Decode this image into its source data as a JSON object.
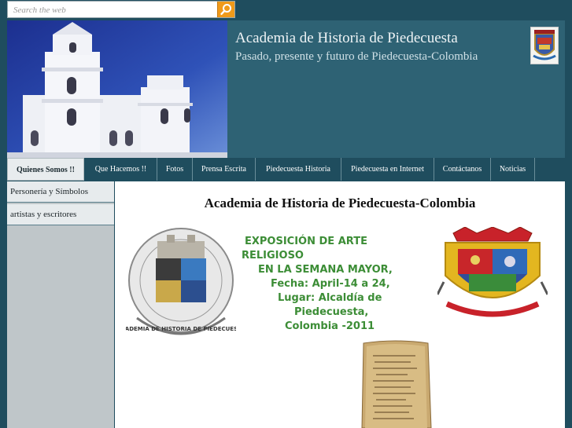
{
  "search": {
    "placeholder": "Search the web"
  },
  "header": {
    "title": "Academia de Historia de Piedecuesta",
    "subtitle": "Pasado, presente y futuro de Piedecuesta-Colombia"
  },
  "nav": {
    "items": [
      {
        "label": "Quienes Somos !!"
      },
      {
        "label": "Que Hacemos !!"
      },
      {
        "label": "Fotos"
      },
      {
        "label": "Prensa Escrita"
      },
      {
        "label": "Piedecuesta Historia"
      },
      {
        "label": "Piedecuesta en Internet"
      },
      {
        "label": "Contáctanos"
      },
      {
        "label": "Noticias"
      }
    ]
  },
  "sidebar": {
    "items": [
      {
        "label": "Personería y Símbolos"
      },
      {
        "label": "artistas y escritores"
      }
    ]
  },
  "main": {
    "heading": "Academia de Historia de Piedecuesta-Colombia",
    "exposition_lines": [
      "EXPOSICIÓN DE ARTE",
      "RELIGIOSO",
      "EN LA SEMANA MAYOR,",
      "Fecha: April-14 a 24,",
      "Lugar: Alcaldía de",
      "Piedecuesta,",
      "Colombia -2011"
    ],
    "logo_left_ring_text": "ACADEMIA DE HISTORIA DE PIEDECUESTA"
  },
  "colors": {
    "background": "#1f4d5e",
    "header": "#2e6274",
    "accent_search": "#f09a1a",
    "exposition_text": "#3c8d36"
  }
}
